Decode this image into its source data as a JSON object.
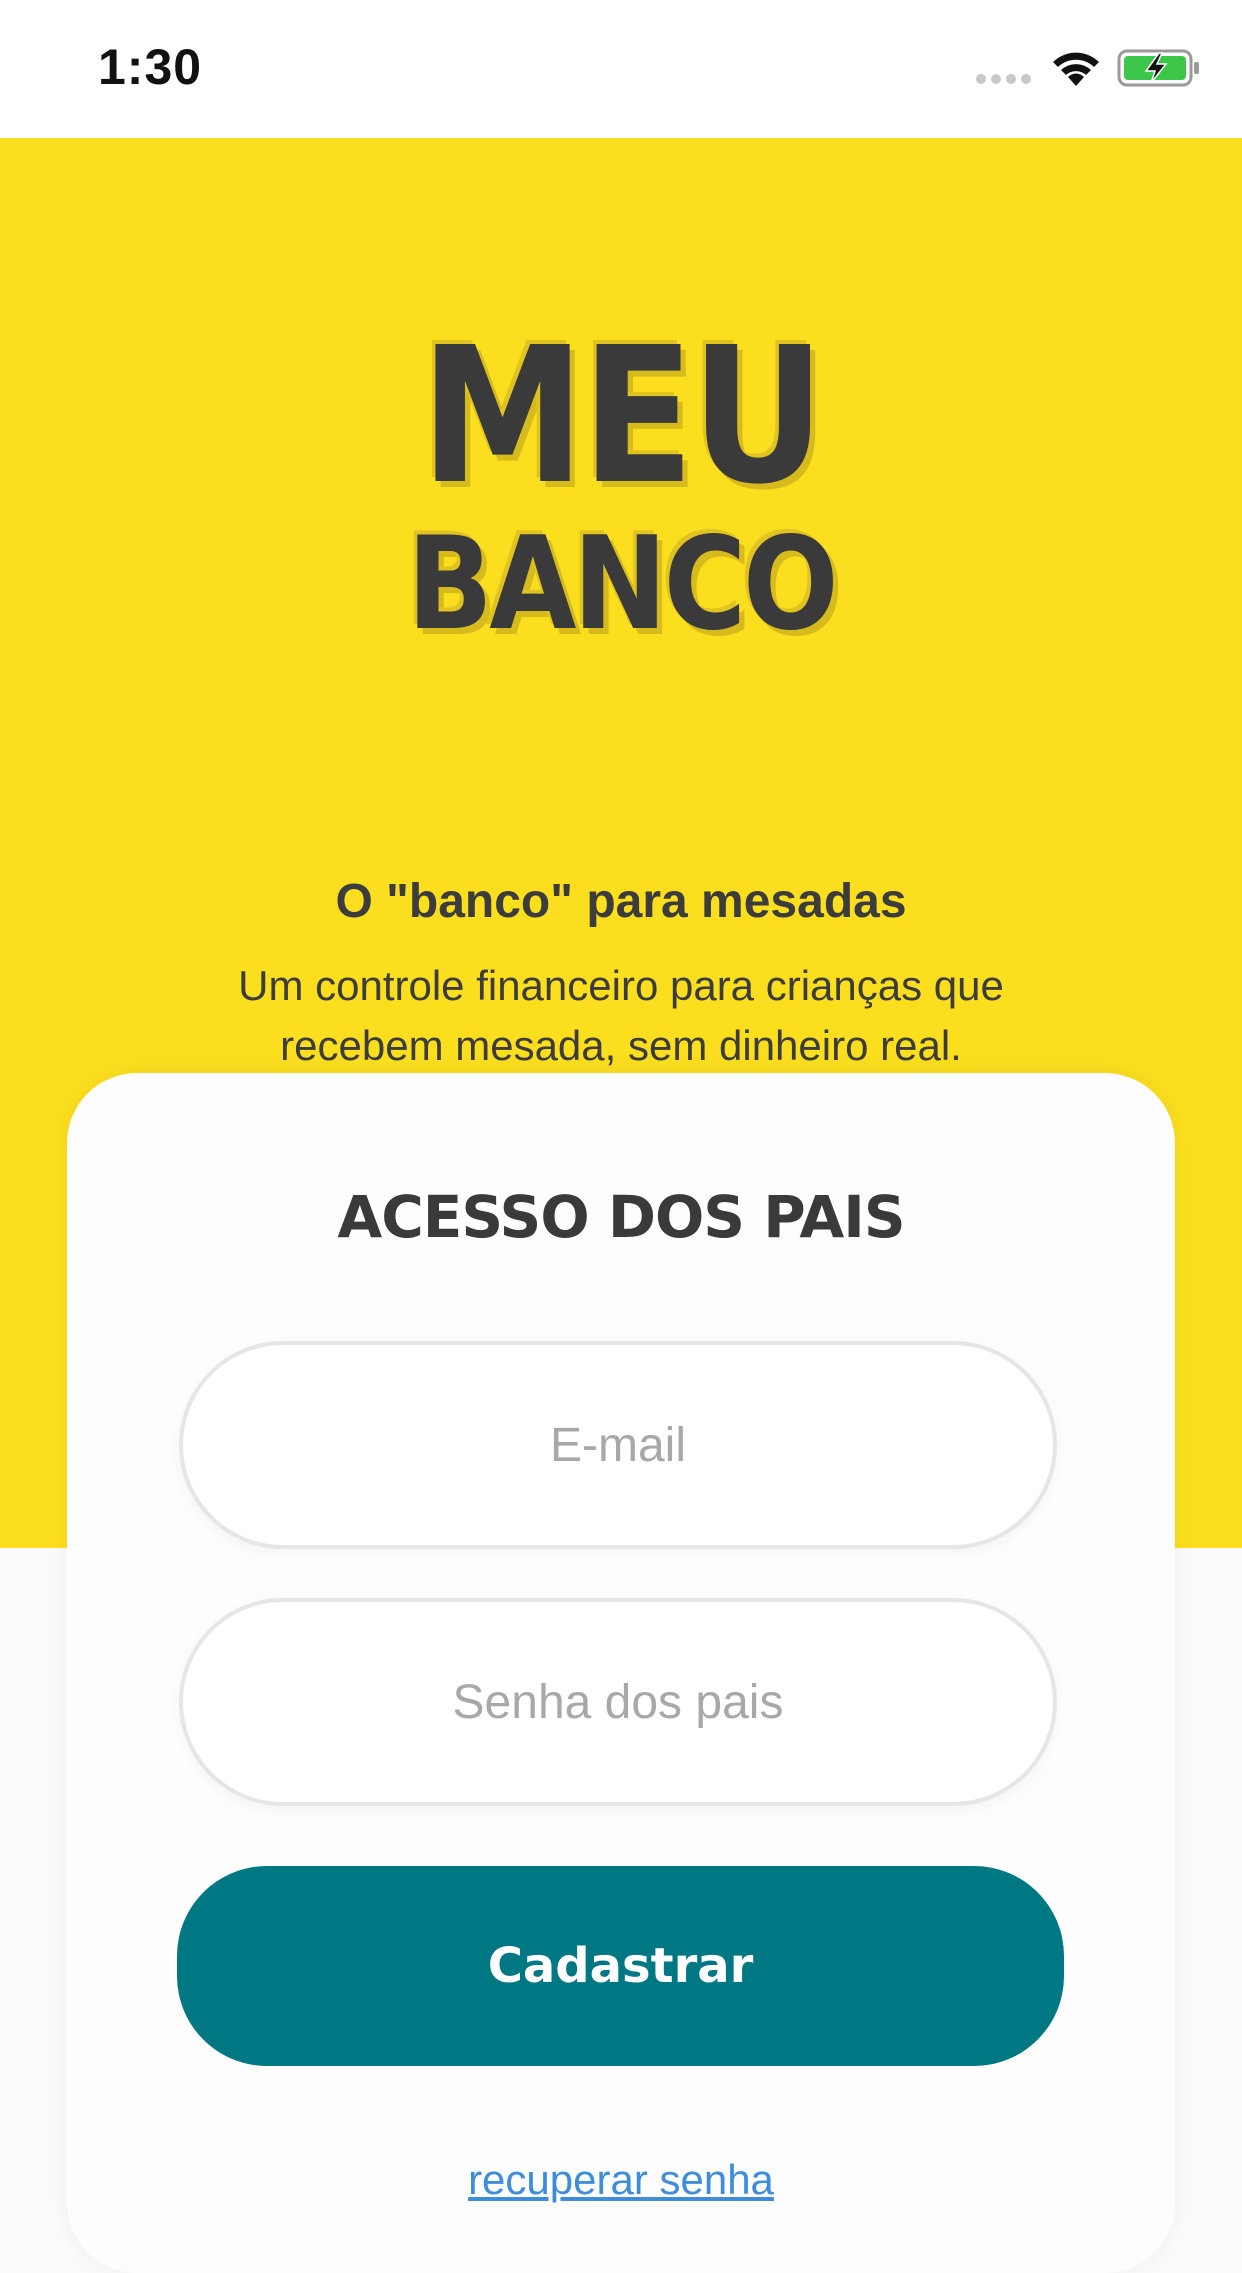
{
  "status_bar": {
    "time": "1:30"
  },
  "logo": {
    "line1": "MEU",
    "line2": "BANCO"
  },
  "hero": {
    "tagline": "O \"banco\" para mesadas",
    "description": "Um controle financeiro para crianças que recebem mesada, sem dinheiro real."
  },
  "login_card": {
    "title": "ACESSO DOS PAIS",
    "email_placeholder": "E-mail",
    "password_placeholder": "Senha dos pais",
    "submit_label": "Cadastrar",
    "recover_label": "recuperar senha"
  },
  "colors": {
    "brand_yellow": "#fbde1e",
    "button_teal": "#007883",
    "link_blue": "#3d8ddb",
    "text_dark": "#3a3a3a"
  },
  "icons": [
    "signal-icon",
    "wifi-icon",
    "battery-charging-icon"
  ]
}
